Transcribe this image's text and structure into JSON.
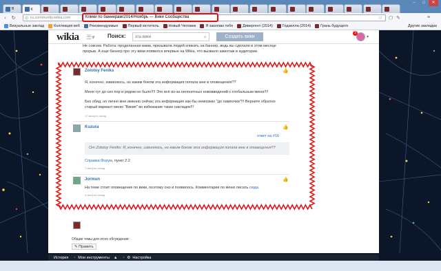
{
  "browser": {
    "tabs": [
      {
        "title": "B",
        "color": "#3b6ea5"
      },
      {
        "title": "K",
        "color": "#3b6ea5"
      },
      {
        "title": "",
        "color": "#7a2a2a"
      },
      {
        "title": "",
        "color": "#7a2a2a"
      },
      {
        "title": "",
        "color": "#7a2a2a"
      },
      {
        "title": "",
        "color": "#7a2a2a"
      },
      {
        "title": "",
        "color": "#7a2a2a"
      },
      {
        "title": "",
        "color": "#7a2a2a"
      },
      {
        "title": "",
        "color": "#7a2a2a"
      },
      {
        "title": "",
        "color": "#7a2a2a"
      },
      {
        "title": "",
        "color": "#7a2a2a"
      },
      {
        "title": "",
        "color": "#7a2a2a"
      },
      {
        "title": "",
        "color": "#7a2a2a"
      },
      {
        "title": "",
        "color": "#7a2a2a"
      },
      {
        "title": "",
        "color": "#7a2a2a"
      },
      {
        "title": "",
        "color": "#7a2a2a"
      },
      {
        "title": "",
        "color": "#7a2a2a"
      },
      {
        "title": "",
        "color": "#7a2a2a"
      },
      {
        "title": "",
        "color": "#7a2a2a"
      },
      {
        "title": "",
        "color": "#7a2a2a"
      },
      {
        "title": "",
        "color": "#7a2a2a"
      }
    ],
    "url": "ru.community.wikia.com",
    "page_title": "Клики по баннерам/2014/Ноябрь — Вики Сообщества",
    "bookmarks": [
      {
        "label": "Визуальные заклад",
        "color": "#4a90e2"
      },
      {
        "label": "Коллекция веб",
        "color": "#f0a030"
      },
      {
        "label": "Рекомендуемые",
        "color": "#3b6ea5"
      },
      {
        "label": "Первый мститель",
        "color": "#7a2a2a"
      },
      {
        "label": "Новый Человек",
        "color": "#7a2a2a"
      },
      {
        "label": "Я закопаю тебя",
        "color": "#7a2a2a"
      },
      {
        "label": "Дивергент (2014)",
        "color": "#7a2a2a"
      },
      {
        "label": "Годзилла (2014)",
        "color": "#7a2a2a"
      },
      {
        "label": "Грань будущего",
        "color": "#7a2a2a"
      }
    ],
    "other_bookmarks": "Другие закладки"
  },
  "wikia": {
    "logo": "wikia",
    "search_label": "Поиск:",
    "search_placeholder": "эта вики",
    "create_wiki": "Создать вики",
    "notif_count": "3"
  },
  "thread": {
    "intro_line1": "Не совсем. Работа: проделанная вами, призывала людей кликать на баннер, ведь вы сделали в этом месяце",
    "intro_line2": "прорыв. А еще баннер про эту вики появился впервые на Wikia, что вызвало ажиотаж в аудитории.",
    "post1": {
      "user": "Zolotoy Feniks",
      "line1": "Я, конечно, извиняюсь, но каким боком эта информация попала мне в оповещения??",
      "line2": "Меня тут до сих пор и рядом не было!!!! Это всё из-за непонятных нововведений с глобальным меню!!!!",
      "line3": "Без обид, но лично мне именно сейчас эта информация как-бы немножко \"до лампочки\"!!! Верните обратно",
      "line4": "старый вариант меню \"Викия\" во избежание таких накладок!!!",
      "time": "12 минуты назад"
    },
    "reply1": {
      "user": "Kuzura",
      "reply_link": "ответ на #16",
      "quote": "От Zolotoy Feniks: Я, конечно, извиняюсь, но каким боком эта информация попала мне в оповещения??",
      "help_link": "Справка:Форум",
      "help_suffix": ", пункт 2.2",
      "time": "7 минуты назад"
    },
    "reply2": {
      "user": "Jormun",
      "text": "На теме стоит оповещение по вики, поэтому оно и появилось. Комментарии по меню писать",
      "link": "сюда",
      "tail": ".",
      "time": "6 минуты назад"
    },
    "general_topics": "Общие темы для этого обсуждения:",
    "edit": "Править"
  },
  "bottom_toolbar": {
    "history": "История",
    "my_tools": "Мои инструменты",
    "settings": "Настройка"
  },
  "colors": {
    "accent": "#2a6fb8",
    "highlight_border": "#e01818",
    "title_box_border": "#d11111",
    "background": "#0b1628"
  }
}
